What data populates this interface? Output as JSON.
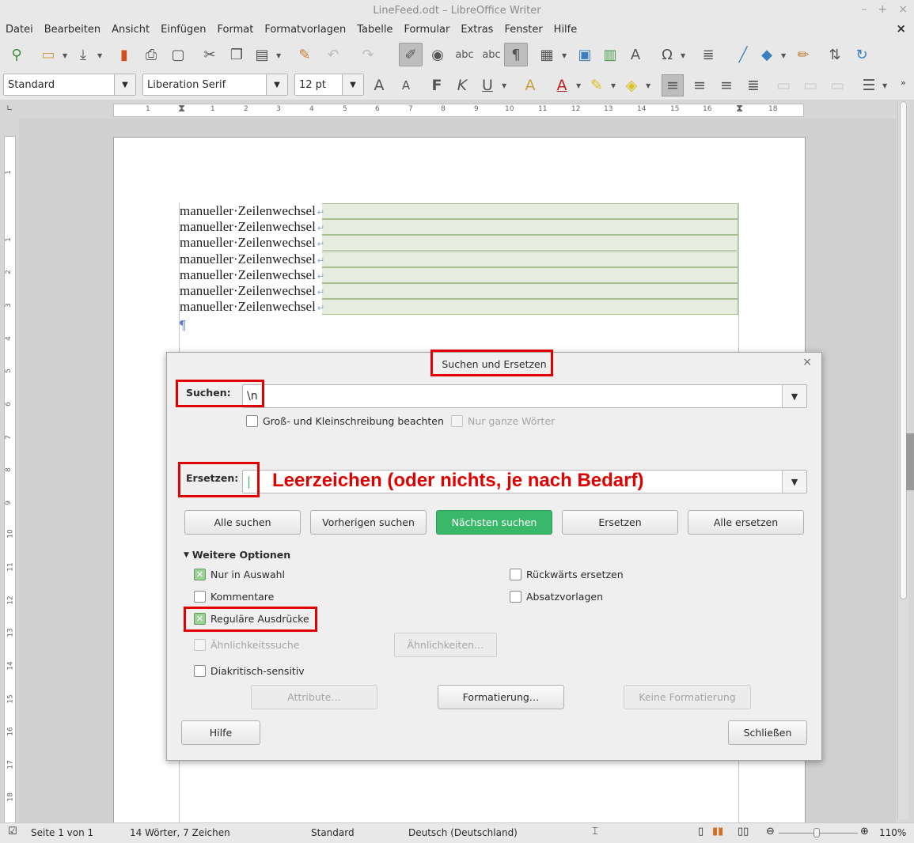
{
  "window": {
    "title": "LineFeed.odt – LibreOffice Writer",
    "controls": [
      "–",
      "+",
      "×"
    ]
  },
  "menu": [
    "Datei",
    "Bearbeiten",
    "Ansicht",
    "Einfügen",
    "Format",
    "Formatvorlagen",
    "Tabelle",
    "Formular",
    "Extras",
    "Fenster",
    "Hilfe"
  ],
  "menu_close": "×",
  "formatting": {
    "paragraph_style": "Standard",
    "font_name": "Liberation Serif",
    "font_size": "12 pt",
    "bold": "F",
    "italic": "K",
    "underline": "U"
  },
  "ruler": {
    "h_numbers": [
      "1",
      "1",
      "2",
      "3",
      "4",
      "5",
      "6",
      "7",
      "8",
      "9",
      "10",
      "11",
      "12",
      "13",
      "14",
      "15",
      "16",
      "17",
      "18"
    ],
    "v_numbers": [
      "1",
      "1",
      "2",
      "3",
      "4",
      "5",
      "6",
      "7",
      "8",
      "9",
      "10",
      "11",
      "12",
      "13",
      "14",
      "15",
      "16",
      "17",
      "18"
    ]
  },
  "document": {
    "lines": [
      "manueller·Zeilenwechsel",
      "manueller·Zeilenwechsel",
      "manueller·Zeilenwechsel",
      "manueller·Zeilenwechsel",
      "manueller·Zeilenwechsel",
      "manueller·Zeilenwechsel",
      "manueller·Zeilenwechsel"
    ],
    "line_break_mark": "↵",
    "paragraph_mark": "¶"
  },
  "dialog": {
    "title": "Suchen und Ersetzen",
    "close": "×",
    "search_label": "Suchen:",
    "search_value": "\\n",
    "match_case": {
      "label": "Groß- und Kleinschreibung beachten",
      "checked": false
    },
    "whole_words": {
      "label": "Nur ganze Wörter",
      "checked": false,
      "enabled": false
    },
    "replace_label": "Ersetzen:",
    "replace_value": "",
    "annotation": "Leerzeichen (oder nichts, je nach Bedarf)",
    "buttons": {
      "find_all": "Alle suchen",
      "find_previous": "Vorherigen suchen",
      "find_next": "Nächsten suchen",
      "replace": "Ersetzen",
      "replace_all": "Alle ersetzen"
    },
    "more_options": "Weitere Optionen",
    "options": {
      "current_selection": {
        "label": "Nur in Auswahl",
        "checked": true
      },
      "backwards": {
        "label": "Rückwärts ersetzen",
        "checked": false
      },
      "comments": {
        "label": "Kommentare",
        "checked": false
      },
      "paragraph_styles": {
        "label": "Absatzvorlagen",
        "checked": false
      },
      "regex": {
        "label": "Reguläre Ausdrücke",
        "checked": true
      },
      "similarity": {
        "label": "Ähnlichkeitssuche",
        "checked": false,
        "enabled": false
      },
      "diacritics": {
        "label": "Diakritisch-sensitiv",
        "checked": false
      }
    },
    "similarities_button": "Ähnlichkeiten…",
    "attributes_button": "Attribute…",
    "format_button": "Formatierung…",
    "no_format_button": "Keine Formatierung",
    "help_button": "Hilfe",
    "close_button": "Schließen"
  },
  "status": {
    "page": "Seite 1 von 1",
    "words": "14 Wörter, 7 Zeichen",
    "page_style": "Standard",
    "language": "Deutsch (Deutschland)",
    "zoom": "110%"
  },
  "colors": {
    "highlight": "#e00000",
    "primary_button": "#3ab86a",
    "selection": "#e6ecde"
  }
}
